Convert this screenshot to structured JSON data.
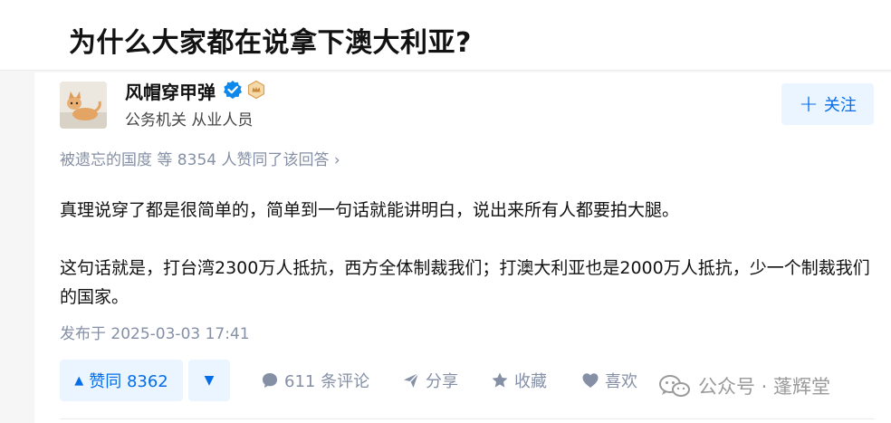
{
  "question": {
    "title": "为什么大家都在说拿下澳大利亚?"
  },
  "author": {
    "name": "风帽穿甲弹",
    "bio": "公务机关 从业人员",
    "follow_label": "关注"
  },
  "voters": {
    "text": "被遗忘的国度 等 8354 人赞同了该回答 ›"
  },
  "content": {
    "paragraphs": [
      "真理说穿了都是很简单的，简单到一句话就能讲明白，说出来所有人都要拍大腿。",
      "这句话就是，打台湾2300万人抵抗，西方全体制裁我们；打澳大利亚也是2000万人抵抗，少一个制裁我们的国家。"
    ]
  },
  "publish_time": "发布于 2025-03-03 17:41",
  "actions": {
    "vote_up": "赞同 8362",
    "comments": "611 条评论",
    "share": "分享",
    "favorite": "收藏",
    "like": "喜欢",
    "more": "…"
  },
  "watermark": {
    "text": "公众号 · 蓬辉堂"
  },
  "colors": {
    "accent": "#056de8",
    "accent_bg": "#ebf5ff",
    "muted": "#8590a6"
  }
}
